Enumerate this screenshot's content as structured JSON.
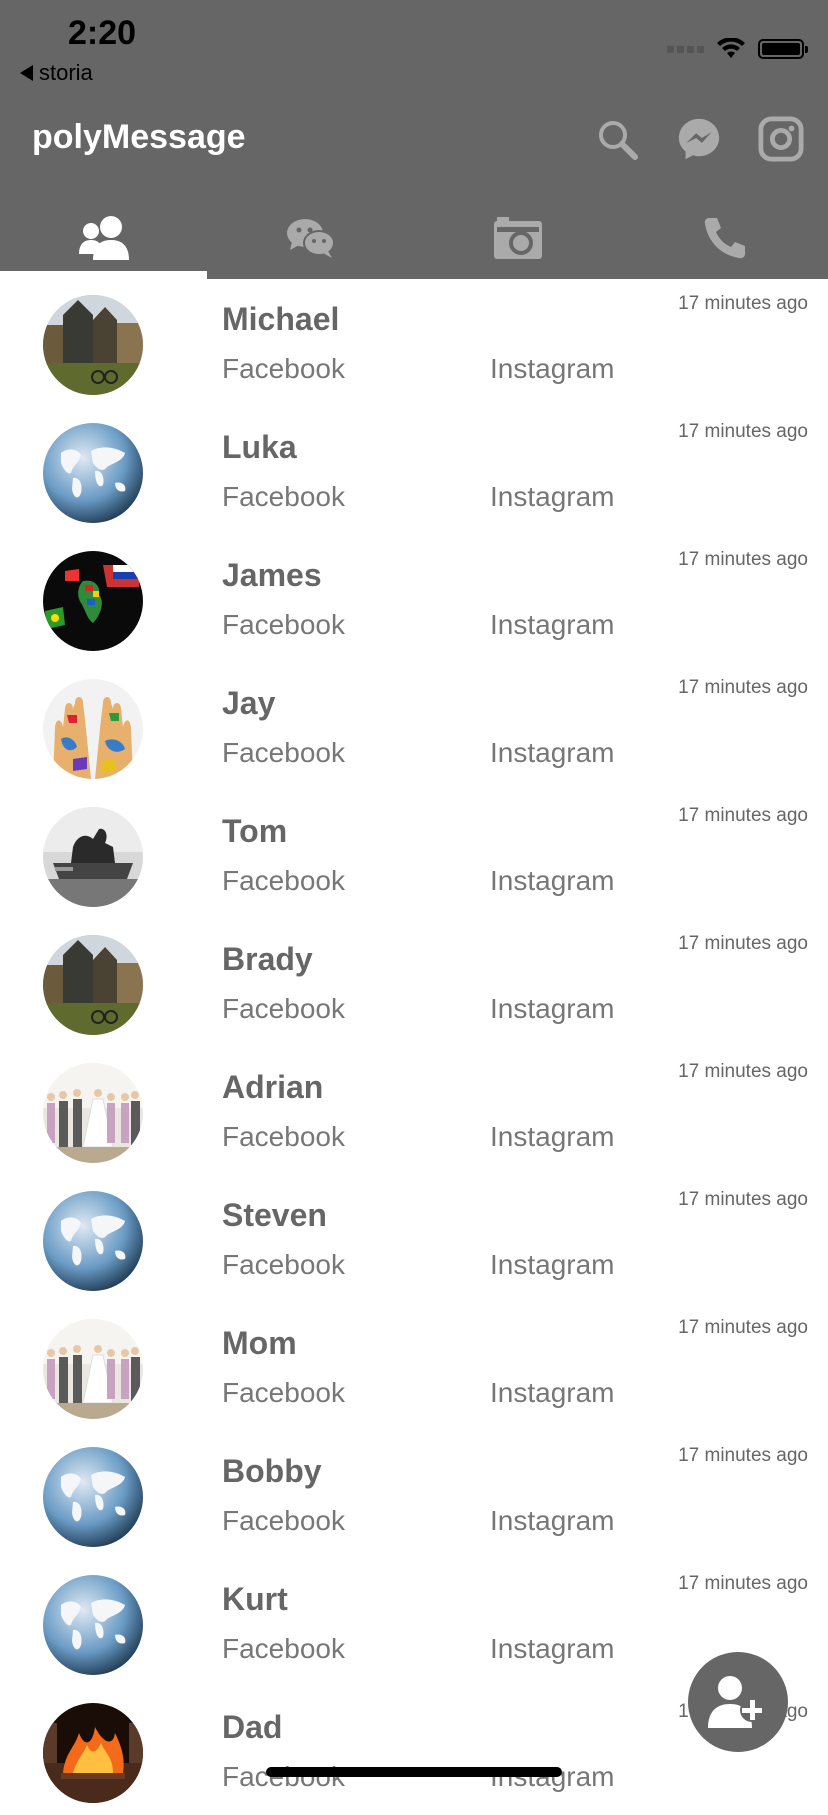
{
  "status_bar": {
    "time": "2:20",
    "back_label": "storia"
  },
  "app": {
    "title": "polyMessage"
  },
  "header_icons": [
    "search-icon",
    "messenger-icon",
    "instagram-icon"
  ],
  "tabs": [
    {
      "icon": "contacts-icon"
    },
    {
      "icon": "chat-bubbles-icon"
    },
    {
      "icon": "camera-icon"
    },
    {
      "icon": "phone-icon"
    }
  ],
  "contacts": [
    {
      "name": "Michael",
      "facebook": "Facebook",
      "instagram": "Instagram",
      "time": "17 minutes ago",
      "avatar": "amsterdam"
    },
    {
      "name": "Luka",
      "facebook": "Facebook",
      "instagram": "Instagram",
      "time": "17 minutes ago",
      "avatar": "globe"
    },
    {
      "name": "James",
      "facebook": "Facebook",
      "instagram": "Instagram",
      "time": "17 minutes ago",
      "avatar": "flags"
    },
    {
      "name": "Jay",
      "facebook": "Facebook",
      "instagram": "Instagram",
      "time": "17 minutes ago",
      "avatar": "hands"
    },
    {
      "name": "Tom",
      "facebook": "Facebook",
      "instagram": "Instagram",
      "time": "17 minutes ago",
      "avatar": "fountain"
    },
    {
      "name": "Brady",
      "facebook": "Facebook",
      "instagram": "Instagram",
      "time": "17 minutes ago",
      "avatar": "amsterdam"
    },
    {
      "name": "Adrian",
      "facebook": "Facebook",
      "instagram": "Instagram",
      "time": "17 minutes ago",
      "avatar": "wedding"
    },
    {
      "name": "Steven",
      "facebook": "Facebook",
      "instagram": "Instagram",
      "time": "17 minutes ago",
      "avatar": "globe"
    },
    {
      "name": "Mom",
      "facebook": "Facebook",
      "instagram": "Instagram",
      "time": "17 minutes ago",
      "avatar": "wedding"
    },
    {
      "name": "Bobby",
      "facebook": "Facebook",
      "instagram": "Instagram",
      "time": "17 minutes ago",
      "avatar": "globe"
    },
    {
      "name": "Kurt",
      "facebook": "Facebook",
      "instagram": "Instagram",
      "time": "17 minutes ago",
      "avatar": "globe"
    },
    {
      "name": "Dad",
      "facebook": "Facebook",
      "instagram": "Instagram",
      "time": "17 minutes ago",
      "avatar": "fire"
    }
  ],
  "fab": {
    "icon": "add-contact-icon"
  },
  "colors": {
    "header": "#666666",
    "text": "#666666",
    "background": "#ffffff"
  }
}
